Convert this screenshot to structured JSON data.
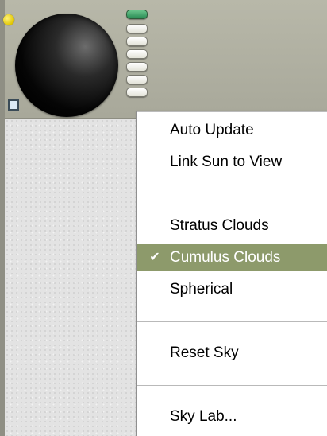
{
  "menu": {
    "items": [
      {
        "label": "Auto Update",
        "checked": false,
        "selected": false
      },
      {
        "label": "Link Sun to View",
        "checked": false,
        "selected": false
      },
      {
        "label": "Stratus Clouds",
        "checked": false,
        "selected": false
      },
      {
        "label": "Cumulus Clouds",
        "checked": true,
        "selected": true
      },
      {
        "label": "Spherical",
        "checked": false,
        "selected": false
      },
      {
        "label": "Reset Sky",
        "checked": false,
        "selected": false
      },
      {
        "label": "Sky Lab...",
        "checked": false,
        "selected": false
      }
    ],
    "check_glyph": "✔"
  },
  "toolbar": {
    "preset_buttons": 6,
    "active_preset_index": 0
  },
  "colors": {
    "menu_selected_bg": "#8d9a6b",
    "active_preset": "#2a8c55",
    "sun_indicator": "#e0c500"
  }
}
